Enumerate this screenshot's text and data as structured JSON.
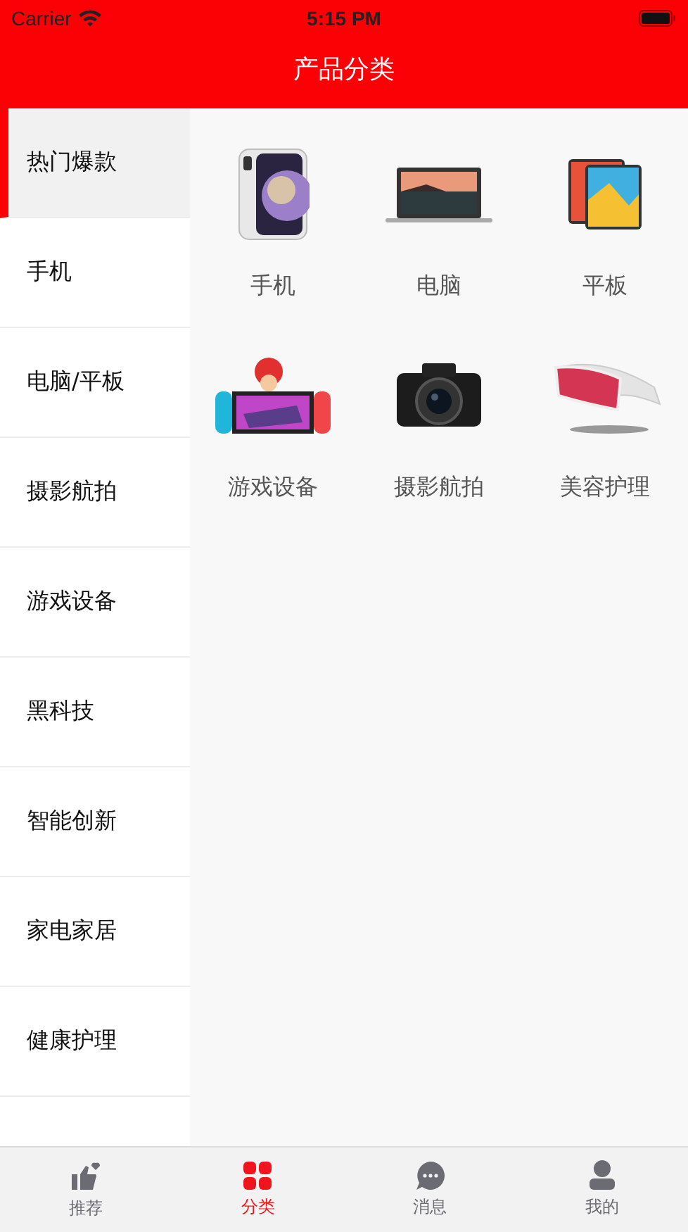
{
  "status_bar": {
    "carrier": "Carrier",
    "time": "5:15 PM"
  },
  "header": {
    "title": "产品分类"
  },
  "sidebar": {
    "items": [
      {
        "label": "热门爆款",
        "selected": true
      },
      {
        "label": "手机",
        "selected": false
      },
      {
        "label": "电脑/平板",
        "selected": false
      },
      {
        "label": "摄影航拍",
        "selected": false
      },
      {
        "label": "游戏设备",
        "selected": false
      },
      {
        "label": "黑科技",
        "selected": false
      },
      {
        "label": "智能创新",
        "selected": false
      },
      {
        "label": "家电家居",
        "selected": false
      },
      {
        "label": "健康护理",
        "selected": false
      }
    ]
  },
  "categories": [
    {
      "label": "手机",
      "kind": "phone"
    },
    {
      "label": "电脑",
      "kind": "laptop"
    },
    {
      "label": "平板",
      "kind": "tablet"
    },
    {
      "label": "游戏设备",
      "kind": "console"
    },
    {
      "label": "摄影航拍",
      "kind": "camera"
    },
    {
      "label": "美容护理",
      "kind": "massager"
    }
  ],
  "tab_bar": [
    {
      "label": "推荐",
      "kind": "thumb",
      "selected": false
    },
    {
      "label": "分类",
      "kind": "grid",
      "selected": true
    },
    {
      "label": "消息",
      "kind": "chat",
      "selected": false
    },
    {
      "label": "我的",
      "kind": "person",
      "selected": false
    }
  ]
}
